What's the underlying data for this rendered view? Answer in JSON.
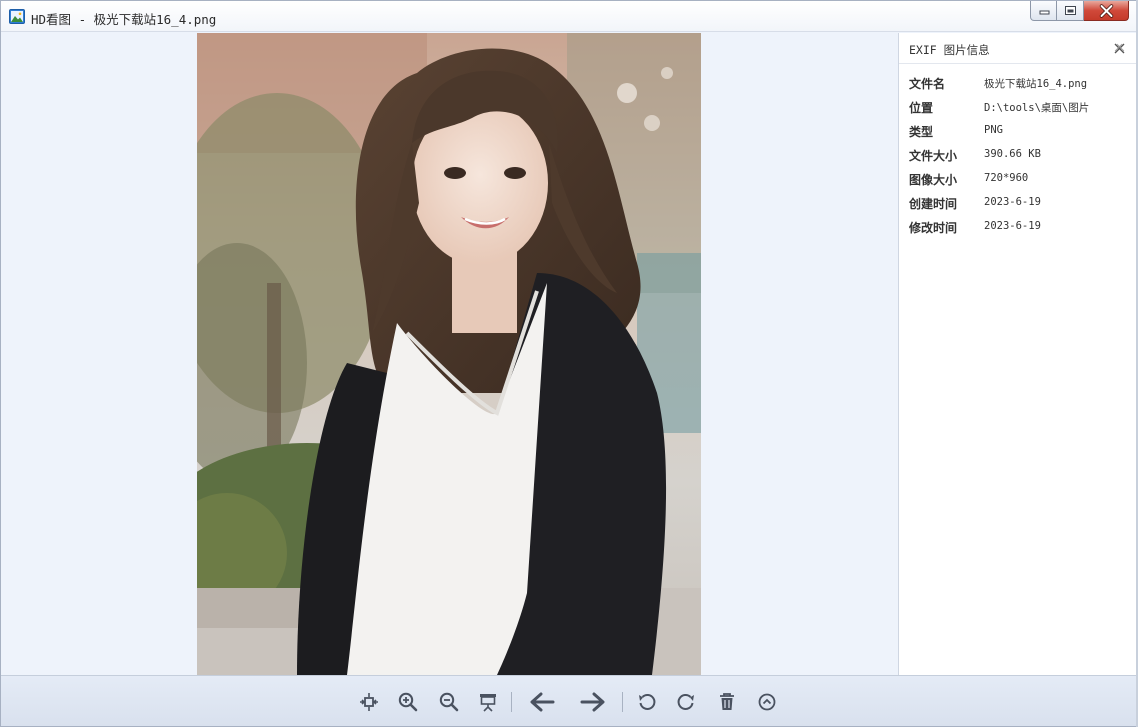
{
  "window": {
    "title": "HD看图 - 极光下载站16_4.png",
    "app_icon": "image-icon"
  },
  "viewer": {
    "image_description_icon": "photo",
    "background_color": "#eef3fb"
  },
  "exif_panel": {
    "title": "EXIF 图片信息",
    "rows": [
      {
        "key": "文件名",
        "value": "极光下载站16_4.png"
      },
      {
        "key": "位置",
        "value": "D:\\tools\\桌面\\图片"
      },
      {
        "key": "类型",
        "value": "PNG"
      },
      {
        "key": "文件大小",
        "value": "390.66 KB"
      },
      {
        "key": "图像大小",
        "value": "720*960"
      },
      {
        "key": "创建时间",
        "value": "2023-6-19"
      },
      {
        "key": "修改时间",
        "value": "2023-6-19"
      }
    ]
  },
  "toolbar": {
    "buttons": [
      {
        "name": "fit-window",
        "icon": "fit-window-icon"
      },
      {
        "name": "zoom-in",
        "icon": "zoom-in-icon"
      },
      {
        "name": "zoom-out",
        "icon": "zoom-out-icon"
      },
      {
        "name": "slideshow",
        "icon": "slideshow-icon"
      },
      {
        "name": "previous",
        "icon": "arrow-left-icon"
      },
      {
        "name": "next",
        "icon": "arrow-right-icon"
      },
      {
        "name": "rotate-left",
        "icon": "rotate-left-icon"
      },
      {
        "name": "rotate-right",
        "icon": "rotate-right-icon"
      },
      {
        "name": "delete",
        "icon": "trash-icon"
      },
      {
        "name": "more",
        "icon": "chevron-up-icon"
      }
    ]
  },
  "colors": {
    "accent_close": "#d0493a",
    "panel_bg": "#ffffff",
    "toolbar_bg": "#dfe6f2",
    "icon_color": "#4a5260"
  }
}
